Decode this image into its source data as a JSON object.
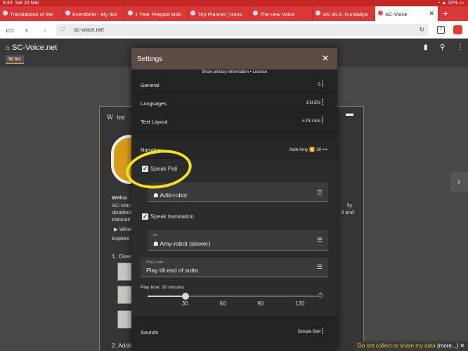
{
  "status": {
    "time": "9:40",
    "date": "Sat 20 Mar",
    "battery": "32%"
  },
  "tabs": [
    {
      "title": "Translations of the"
    },
    {
      "title": "Eventbrite - My tick"
    },
    {
      "title": "1 Year Prepaid Mob"
    },
    {
      "title": "Trip Planner | trans"
    },
    {
      "title": "The new Voice"
    },
    {
      "title": "SN 46.6: Kundaliya"
    },
    {
      "title": "SC-Voice",
      "active": true
    }
  ],
  "address": {
    "url": "sc-voice.net",
    "tab_count": "7"
  },
  "app": {
    "title": "SC-Voice.net",
    "chip": "toc"
  },
  "background": {
    "card_title": "toc",
    "welcome": "Welco",
    "para": [
      "SC-Voic",
      "disabled",
      "translati"
    ],
    "para_right": [
      "lly",
      "li and"
    ],
    "what": "▶ What",
    "explore": "Explore",
    "section1": "1. Over",
    "section2": "2. Additional information"
  },
  "cookie": {
    "text": "Do not collect or share my data",
    "more": "(more...)"
  },
  "settings": {
    "title": "Settings",
    "links": "Show privacy information • License",
    "general": {
      "label": "General",
      "value": "5"
    },
    "languages": {
      "label": "Languages",
      "value": "EN EN"
    },
    "text_layout": {
      "label": "Text Layout",
      "value": "# PLI EN"
    },
    "narration": {
      "label": "Narration",
      "value": "Aditi Amy ⏫ 30 •••"
    },
    "speak_pali": {
      "label": "Speak Pali",
      "checked": true
    },
    "pali_voice": {
      "value": "Aditi-robot"
    },
    "speak_translation": {
      "label": "Speak translation",
      "checked": true
    },
    "trans_voice": {
      "lang": "en",
      "value": "Amy-robot (slower)"
    },
    "play": {
      "label": "Play sutta...",
      "value": "Play till end of sutta"
    },
    "play_time": {
      "label": "Play time: 30 minutes",
      "value": 30,
      "min": 0,
      "max": 135,
      "ticks": [
        "30",
        "60",
        "90",
        "120"
      ]
    },
    "sounds": {
      "label": "Sounds",
      "value": "Simple Bell"
    }
  },
  "colors": {
    "accent": "#d93838",
    "highlight": "#f5e020",
    "dialog_header": "#5c4b45"
  }
}
